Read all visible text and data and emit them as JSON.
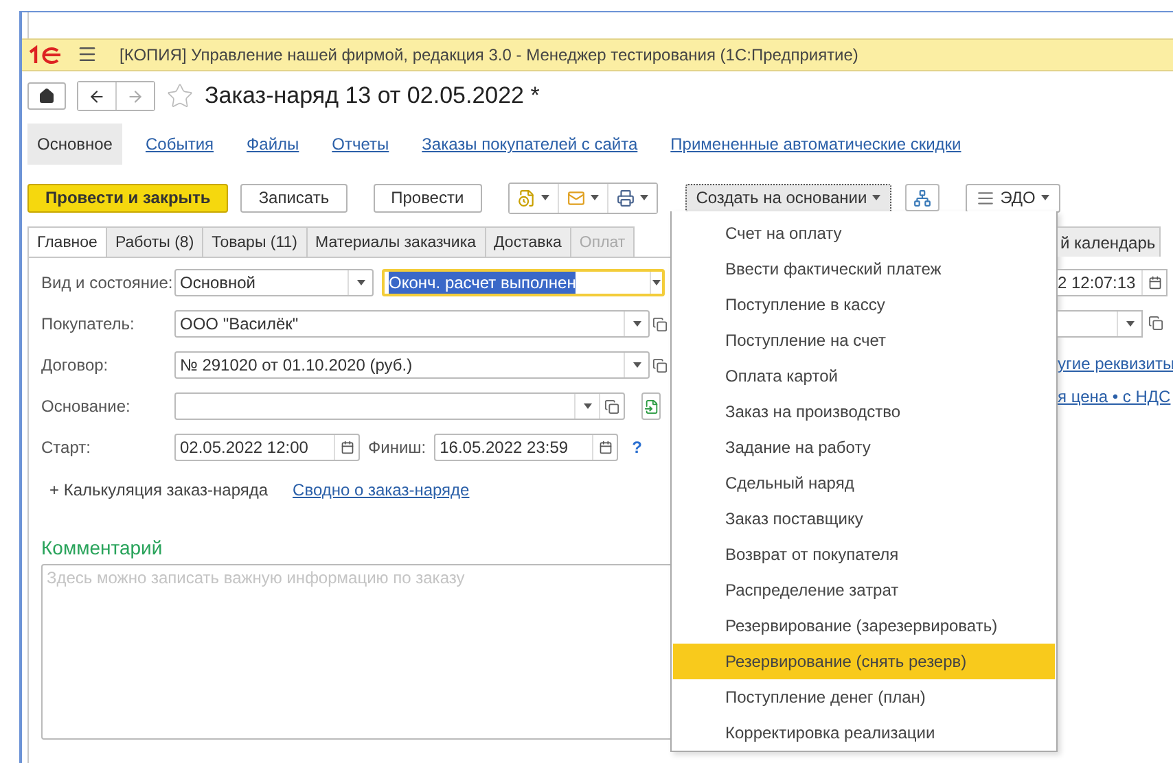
{
  "app": {
    "title": "[КОПИЯ] Управление нашей фирмой, редакция 3.0  - Менеджер тестирования (1С:Предприятие)"
  },
  "document": {
    "title": "Заказ-наряд 13 от 02.05.2022 *",
    "favorite": false
  },
  "sections": [
    {
      "label": "Основное",
      "selected": true
    },
    {
      "label": "События",
      "selected": false
    },
    {
      "label": "Файлы",
      "selected": false
    },
    {
      "label": "Отчеты",
      "selected": false
    },
    {
      "label": "Заказы покупателей с сайта",
      "selected": false
    },
    {
      "label": "Примененные автоматические скидки",
      "selected": false
    }
  ],
  "toolbar": [
    {
      "kind": "primary",
      "label": "Провести и закрыть"
    },
    {
      "kind": "plain",
      "label": "Записать"
    },
    {
      "kind": "plain",
      "label": "Провести"
    },
    {
      "kind": "icon-group"
    },
    {
      "kind": "menu",
      "label": "Создать на основании",
      "pressed": true
    },
    {
      "kind": "structure"
    },
    {
      "kind": "menu",
      "label": "ЭДО",
      "pressed": false
    }
  ],
  "tabs": [
    {
      "label": "Главное",
      "selected": true,
      "disabled": false
    },
    {
      "label": "Работы (8)",
      "selected": false,
      "disabled": false
    },
    {
      "label": "Товары (11)",
      "selected": false,
      "disabled": false
    },
    {
      "label": "Материалы заказчика",
      "selected": false,
      "disabled": false
    },
    {
      "label": "Доставка",
      "selected": false,
      "disabled": false
    },
    {
      "label": "Оплат",
      "selected": false,
      "disabled": true
    }
  ],
  "form": [
    {
      "kind": "state",
      "label": "Вид и состояние:",
      "value": "Основной",
      "status": "Оконч. расчет выполнен"
    },
    {
      "kind": "combo",
      "label": "Покупатель:",
      "value": "ООО \"Василёк\""
    },
    {
      "kind": "combo",
      "label": "Договор:",
      "value": "№ 291020 от 01.10.2020 (руб.)"
    },
    {
      "kind": "basis",
      "label": "Основание:"
    },
    {
      "kind": "dates",
      "label": "Старт:",
      "value": "02.05.2022 12:00",
      "label2": "Финиш:",
      "value2": "16.05.2022 23:59",
      "help": "?"
    }
  ],
  "extras": {
    "toggle": "+ Калькуляция заказ-наряда",
    "link": "Сводно о заказ-наряде"
  },
  "comment": {
    "title": "Комментарий",
    "placeholder": "Здесь можно записать важную информацию по заказу"
  },
  "right_side": {
    "tab": "й календарь",
    "date_value": "2 12:07:13",
    "links": [
      "угие реквизиты",
      "я цена • с НДС"
    ]
  },
  "menu": [
    {
      "label": "Счет на оплату",
      "selected": false
    },
    {
      "label": "Ввести фактический платеж",
      "selected": false
    },
    {
      "label": "Поступление в кассу",
      "selected": false
    },
    {
      "label": "Поступление на счет",
      "selected": false
    },
    {
      "label": "Оплата картой",
      "selected": false
    },
    {
      "label": "Заказ на производство",
      "selected": false
    },
    {
      "label": "Задание на работу",
      "selected": false
    },
    {
      "label": "Сдельный наряд",
      "selected": false
    },
    {
      "label": "Заказ поставщику",
      "selected": false
    },
    {
      "label": "Возврат от покупателя",
      "selected": false
    },
    {
      "label": "Распределение затрат",
      "selected": false
    },
    {
      "label": "Резервирование (зарезервировать)",
      "selected": false
    },
    {
      "label": "Резервирование (снять резерв)",
      "selected": true
    },
    {
      "label": "Поступление денег (план)",
      "selected": false
    },
    {
      "label": "Корректировка реализации",
      "selected": false
    }
  ]
}
